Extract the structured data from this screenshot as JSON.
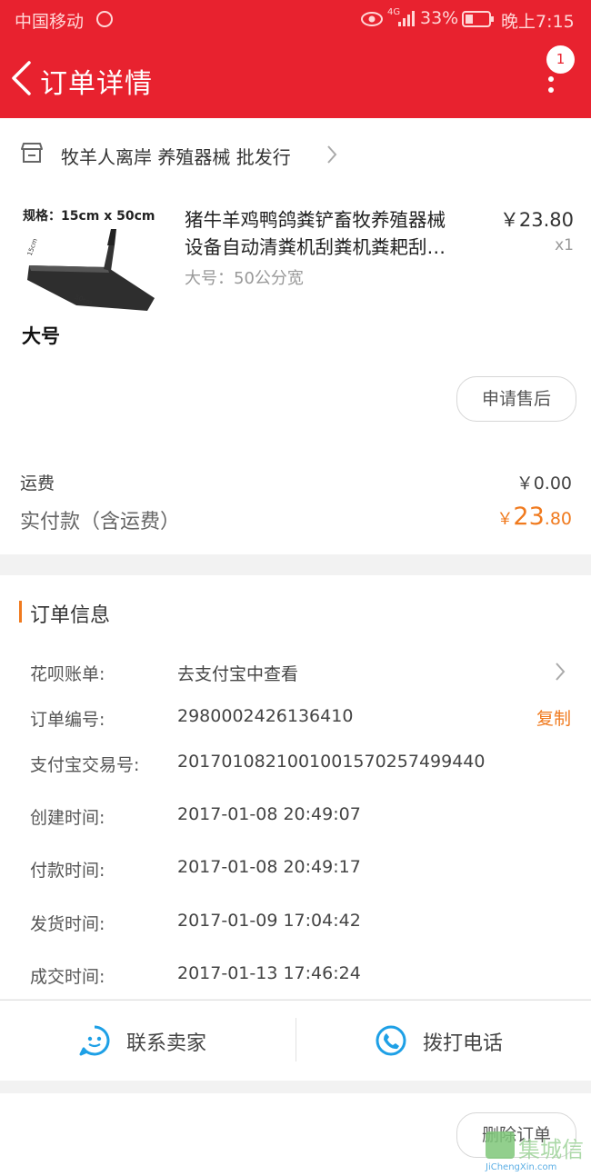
{
  "status_bar": {
    "carrier": "中国移动",
    "network": "4G",
    "battery": "33%",
    "time": "晚上7:15"
  },
  "header": {
    "title": "订单详情",
    "badge_count": "1"
  },
  "shop": {
    "name": "牧羊人离岸 养殖器械 批发行"
  },
  "product": {
    "image_spec": "规格：15cm x 50cm",
    "image_dim_a": "15cm",
    "image_dim_b": "50cm",
    "image_size": "大号",
    "title_line1": "猪牛羊鸡鸭鸽粪铲畜牧养殖器械",
    "title_line2": "设备自动清粪机刮粪机粪耙刮…",
    "price": "￥23.80",
    "quantity": "x1",
    "sku": "大号：50公分宽",
    "after_sale_button": "申请售后"
  },
  "summary": {
    "shipping_label": "运费",
    "shipping_value": "￥0.00",
    "paid_label": "实付款（含运费）",
    "paid_currency": "￥",
    "paid_integer": "23",
    "paid_decimal": ".80"
  },
  "order_info": {
    "section_title": "订单信息",
    "rows": [
      {
        "label": "花呗账单:",
        "value": "去支付宝中查看"
      },
      {
        "label": "订单编号:",
        "value": "2980002426136410",
        "action": "复制"
      },
      {
        "label": "支付宝交易号:",
        "value": "2017010821001001570257499440"
      },
      {
        "label": "创建时间:",
        "value": "2017-01-08 20:49:07"
      },
      {
        "label": "付款时间:",
        "value": "2017-01-08 20:49:17"
      },
      {
        "label": "发货时间:",
        "value": "2017-01-09 17:04:42"
      },
      {
        "label": "成交时间:",
        "value": "2017-01-13 17:46:24"
      }
    ]
  },
  "actions": {
    "contact_seller": "联系卖家",
    "call": "拨打电话",
    "delete_order": "删除订单"
  },
  "watermark": {
    "text": "JiChengXin.com",
    "brand": "集城信"
  },
  "colors": {
    "header_red": "#e8222f",
    "accent_orange": "#f07a1e",
    "icon_blue": "#1ea0e6"
  }
}
